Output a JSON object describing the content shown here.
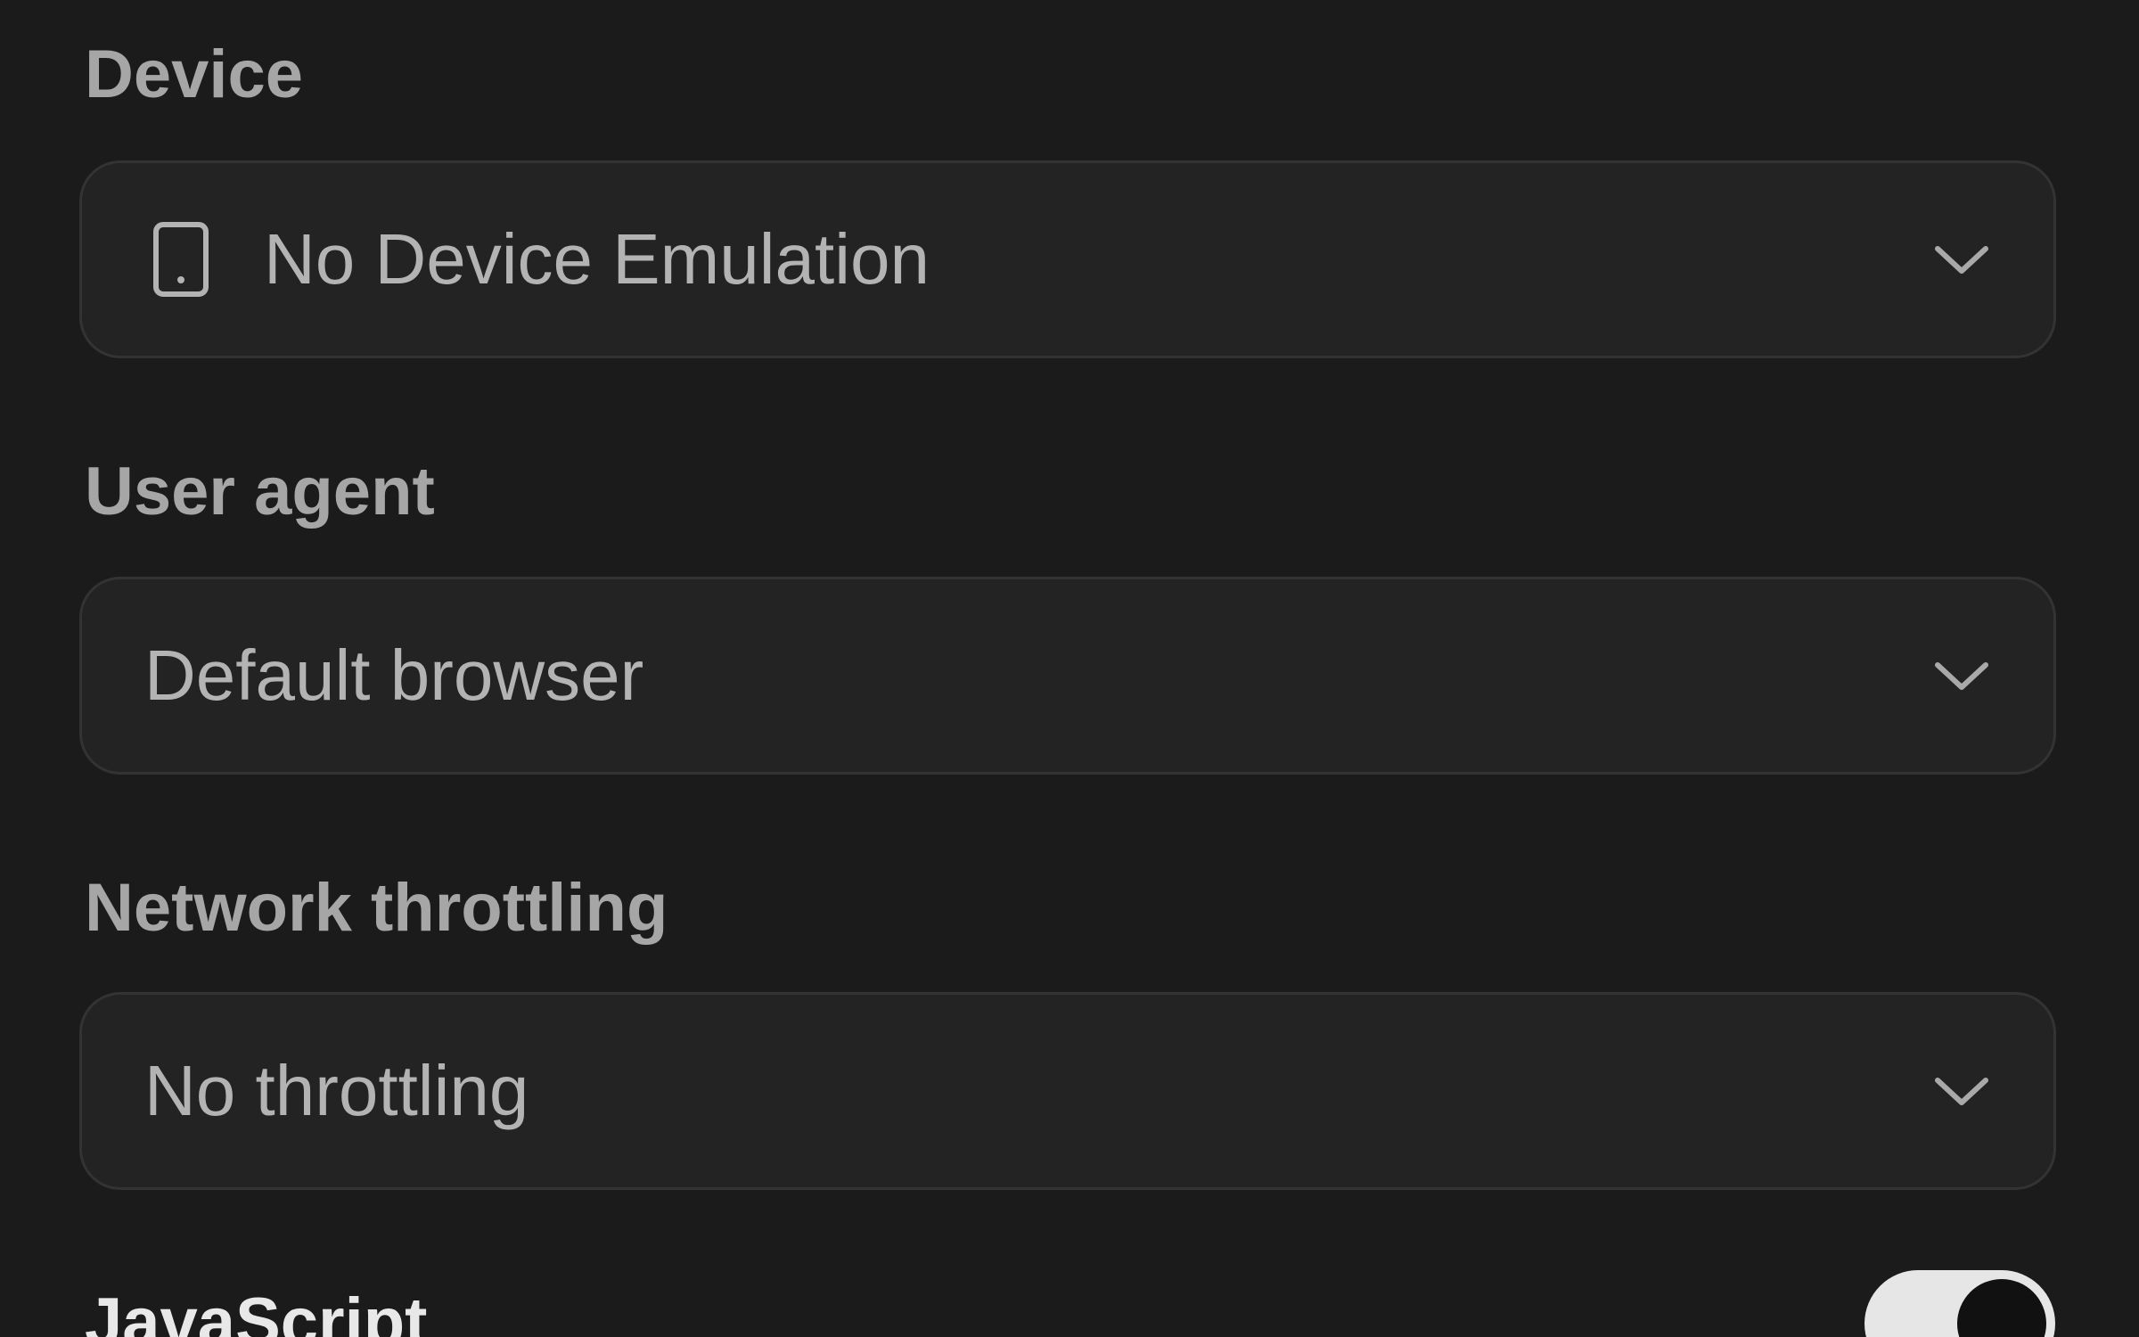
{
  "device": {
    "label": "Device",
    "value": "No Device Emulation",
    "icon": "mobile-device-icon"
  },
  "user_agent": {
    "label": "User agent",
    "value": "Default browser"
  },
  "network": {
    "label": "Network throttling",
    "value": "No throttling"
  },
  "javascript": {
    "label": "JavaScript",
    "enabled": true
  },
  "colors": {
    "background": "#1b1b1b",
    "field": "#232323",
    "border": "#333333",
    "text": "#b3b3b3",
    "toggle_track": "#e6e6e6",
    "toggle_knob": "#111111"
  }
}
